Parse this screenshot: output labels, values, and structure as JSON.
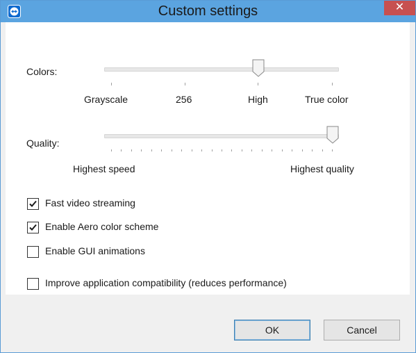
{
  "window": {
    "title": "Custom settings",
    "close_symbol": "✕",
    "app_icon": "teamviewer-icon",
    "title_bar_color": "#5ba4e0",
    "close_button_color": "#c75050"
  },
  "colors": {
    "label": "Colors:",
    "options": [
      "Grayscale",
      "256",
      "High",
      "True color"
    ],
    "selected": "High",
    "selected_index": 2
  },
  "quality": {
    "label": "Quality:",
    "min_label": "Highest speed",
    "max_label": "Highest quality",
    "level": 1.0
  },
  "options": [
    {
      "label": "Fast video streaming",
      "checked": true
    },
    {
      "label": "Enable Aero color scheme",
      "checked": true
    },
    {
      "label": "Enable GUI animations",
      "checked": false
    },
    {
      "label": "Improve application compatibility (reduces performance)",
      "checked": false
    }
  ],
  "buttons": {
    "ok": "OK",
    "cancel": "Cancel"
  }
}
